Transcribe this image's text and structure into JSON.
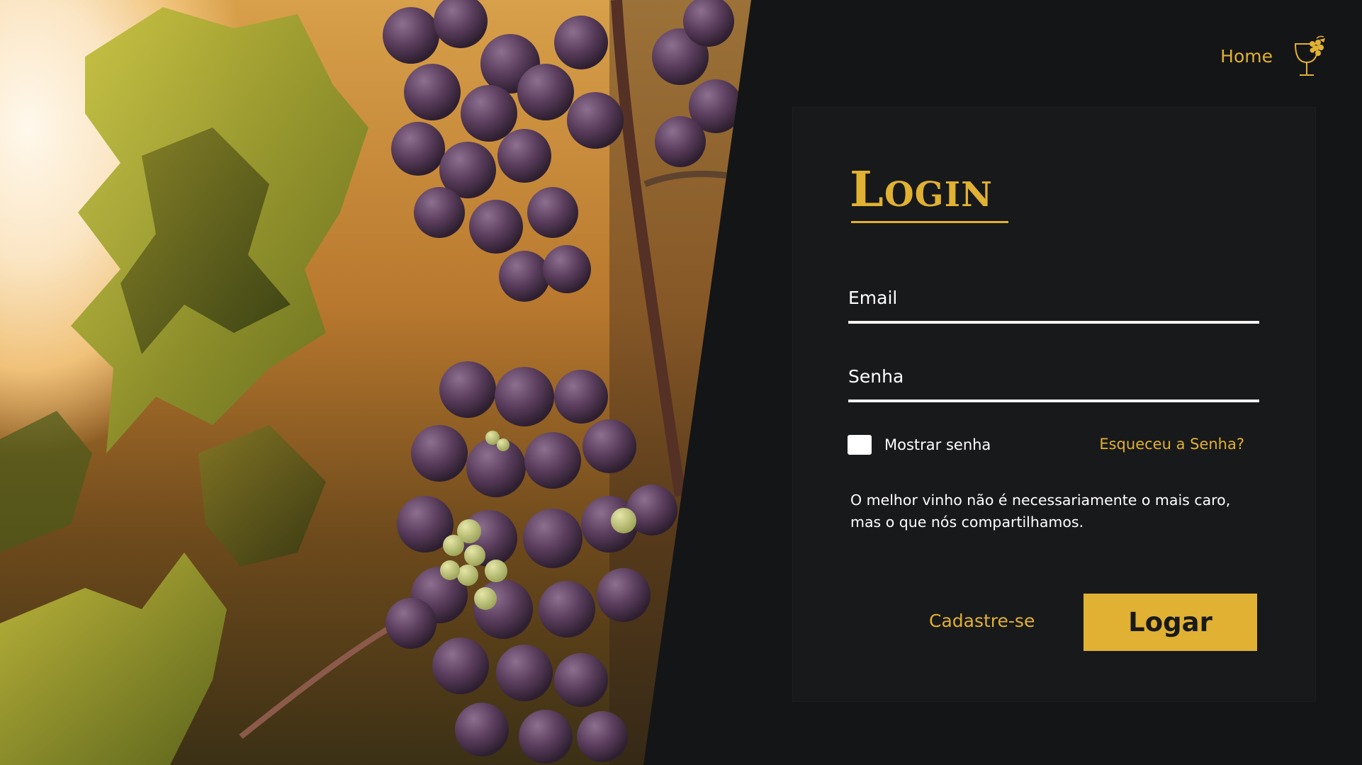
{
  "nav": {
    "home_label": "Home",
    "logo_icon": "wine-glass-grapes-icon"
  },
  "login": {
    "title": "Login",
    "email_label": "Email",
    "email_value": "",
    "password_label": "Senha",
    "password_value": "",
    "show_password_label": "Mostrar senha",
    "show_password_checked": false,
    "forgot_label": "Esqueceu a Senha?",
    "quote": "O melhor vinho não é necessariamente o mais caro, mas o que nós compartilhamos.",
    "signup_label": "Cadastre-se",
    "submit_label": "Logar"
  },
  "colors": {
    "background": "#141517",
    "card": "#18191b",
    "accent": "#e0b132",
    "text": "#ffffff"
  }
}
